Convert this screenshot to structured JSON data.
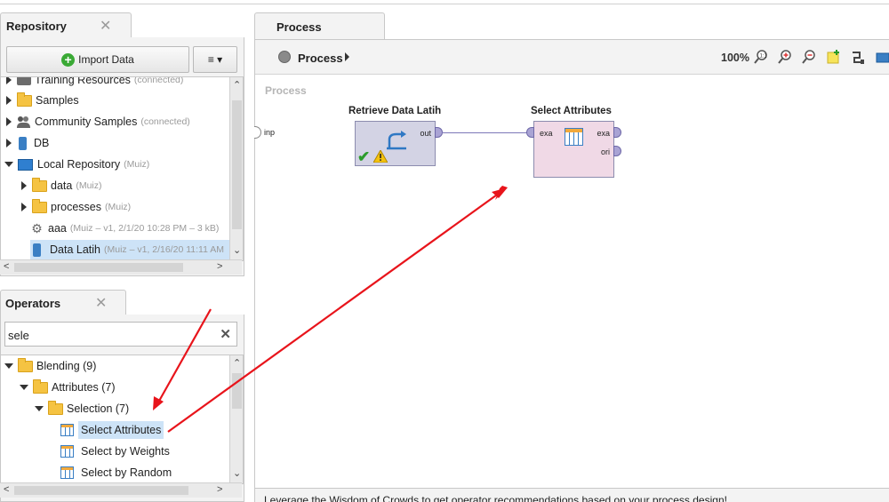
{
  "repository": {
    "tab_title": "Repository",
    "import_label": "Import Data",
    "menu_label": "≡ ▾",
    "items": [
      {
        "label": "Training Resources",
        "meta": "(connected)"
      },
      {
        "label": "Samples",
        "meta": ""
      },
      {
        "label": "Community Samples",
        "meta": "(connected)"
      },
      {
        "label": "DB",
        "meta": ""
      },
      {
        "label": "Local Repository",
        "meta": "(Muiz)"
      },
      {
        "label": "data",
        "meta": "(Muiz)"
      },
      {
        "label": "processes",
        "meta": "(Muiz)"
      },
      {
        "label": "aaa",
        "meta": "(Muiz – v1, 2/1/20 10:28 PM – 3 kB)"
      },
      {
        "label": "Data Latih",
        "meta": "(Muiz – v1, 2/16/20 11:11 AM"
      }
    ]
  },
  "operators": {
    "tab_title": "Operators",
    "search_value": "sele",
    "items": [
      {
        "label": "Blending (9)"
      },
      {
        "label": "Attributes (7)"
      },
      {
        "label": "Selection (7)"
      },
      {
        "label": "Select Attributes"
      },
      {
        "label": "Select by Weights"
      },
      {
        "label": "Select by Random"
      }
    ]
  },
  "process": {
    "tab_title": "Process",
    "breadcrumb": "Process",
    "zoom": "100%",
    "canvas_label": "Process",
    "input_port": "inp",
    "op1": {
      "title": "Retrieve Data Latih",
      "out": "out"
    },
    "op2": {
      "title": "Select Attributes",
      "in": "exa",
      "out1": "exa",
      "out2": "ori"
    },
    "footer_text": "Leverage the Wisdom of Crowds to get operator recommendations based on your process design!"
  },
  "colors": {
    "annotation_arrow": "#e8141b",
    "selection": "#cde3f7",
    "port": "#a9a3d4"
  }
}
